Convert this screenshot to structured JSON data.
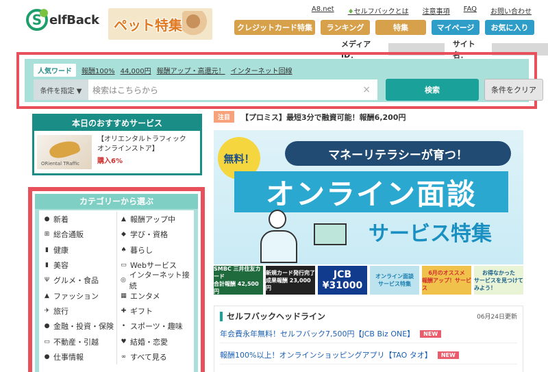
{
  "header": {
    "logo_s": "S",
    "logo_text": "elfBack",
    "pet_banner": "ペット特集",
    "toplinks": [
      "A8.net",
      "セルフバックとは",
      "注意事項",
      "FAQ",
      "お問い合わせ"
    ],
    "nav": [
      {
        "label": "クレジットカード特集",
        "color": "#d7a04a"
      },
      {
        "label": "ランキング",
        "color": "#d7a04a"
      },
      {
        "label": "特集",
        "color": "#d7a04a"
      },
      {
        "label": "マイページ",
        "color": "#2e9ec9"
      },
      {
        "label": "お気に入り",
        "color": "#2e9ec9"
      }
    ],
    "media_id_label": "メディアID：",
    "site_name_label": "サイト名："
  },
  "search": {
    "popular_tag": "人気ワード",
    "popular_words": [
      "報酬100%",
      "44,000円",
      "報酬アップ・高還元！",
      "インターネット回線"
    ],
    "condition_label": "条件を指定 ▼",
    "placeholder": "検索はこちらから",
    "clear_icon": "×",
    "search_label": "検索",
    "clear_label": "条件をクリア"
  },
  "recommend": {
    "title": "本日のおすすめサービス",
    "thumb_brand": "ORiental TRaffic",
    "name": "【オリエンタルトラフィック オンラインストア】",
    "rate": "購入6%"
  },
  "categories": {
    "title": "カテゴリーから選ぶ",
    "items": [
      {
        "label": "新着",
        "icon": "●"
      },
      {
        "label": "報酬アップ中",
        "icon": "▲"
      },
      {
        "label": "総合通販",
        "icon": "⊞"
      },
      {
        "label": "学び・資格",
        "icon": "◆"
      },
      {
        "label": "健康",
        "icon": "▮"
      },
      {
        "label": "暮らし",
        "icon": "♠"
      },
      {
        "label": "美容",
        "icon": "▮"
      },
      {
        "label": "Webサービス",
        "icon": "▭"
      },
      {
        "label": "グルメ・食品",
        "icon": "Ψ"
      },
      {
        "label": "インターネット接続",
        "icon": "◎"
      },
      {
        "label": "ファッション",
        "icon": "▲"
      },
      {
        "label": "エンタメ",
        "icon": "▦"
      },
      {
        "label": "旅行",
        "icon": "✈"
      },
      {
        "label": "ギフト",
        "icon": "✚"
      },
      {
        "label": "金融・投資・保険",
        "icon": "●"
      },
      {
        "label": "スポーツ・趣味",
        "icon": "•"
      },
      {
        "label": "不動産・引越",
        "icon": "▭"
      },
      {
        "label": "結婚・恋愛",
        "icon": "♥"
      },
      {
        "label": "仕事情報",
        "icon": "●"
      },
      {
        "label": "すべて見る",
        "icon": "∞"
      }
    ]
  },
  "notice": {
    "badge": "注目",
    "text": "【プロミス】最短3分で融資可能！報酬6,200円"
  },
  "hero": {
    "free": "無料！",
    "pill": "マネーリテラシーが育つ！",
    "big": "オンライン面談",
    "sub": "サービス特集"
  },
  "strip": [
    {
      "line1": "SMBC 三井住友カード",
      "line2": "合計報酬 42,500円"
    },
    {
      "line1": "新規カード発行完了",
      "line2": "成果報酬 23,000円"
    },
    {
      "line1": "JCB",
      "line2": "¥31000"
    },
    {
      "line1": "オンライン面談",
      "line2": "サービス特集"
    },
    {
      "line1": "6月のオススメ",
      "line2": "報酬アップ！サービス"
    },
    {
      "line1": "お得なかった",
      "line2": "サービスを見つけてみよう！"
    }
  ],
  "headline": {
    "title": "セルフバックヘッドライン",
    "date": "06月24日更新",
    "items": [
      {
        "text": "年会費永年無料！セルフバック7,500円【JCB Biz ONE】",
        "badge": "NEW"
      },
      {
        "text": "報酬100%以上！オンラインショッピングアプリ【TAO タオ】",
        "badge": "NEW"
      }
    ]
  }
}
